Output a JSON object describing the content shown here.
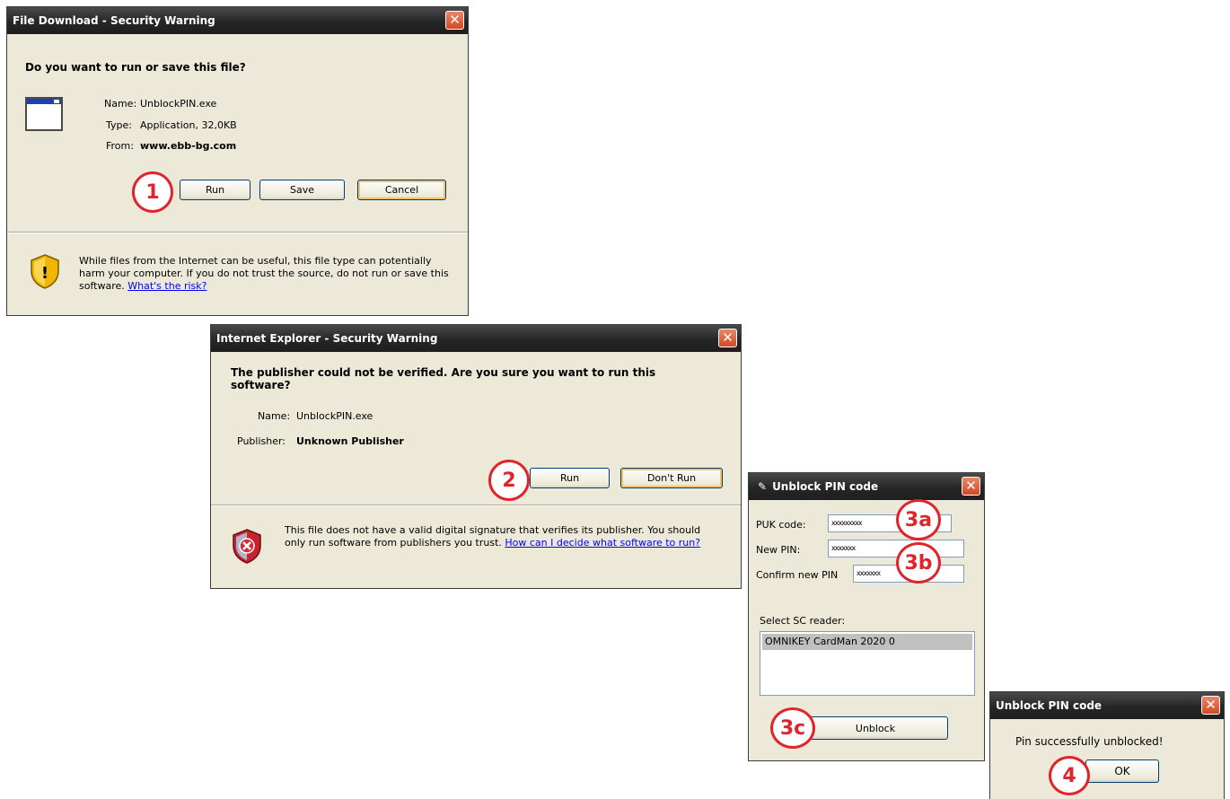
{
  "dialog1": {
    "title": "File Download - Security Warning",
    "close_glyph": "✕",
    "question": "Do you want to run or save this file?",
    "name_label": "Name:",
    "name_value": "UnblockPIN.exe",
    "type_label": "Type:",
    "type_value": "Application, 32,0KB",
    "from_label": "From:",
    "from_value": "www.ebb-bg.com",
    "run_label": "Run",
    "save_label": "Save",
    "cancel_label": "Cancel",
    "warning_text": "While files from the Internet can be useful, this file type can potentially harm your computer. If you do not trust the source, do not run or save this software.",
    "risk_link": "What's the risk?",
    "icon": "application-window-icon",
    "shield_icon": "warning-shield-icon"
  },
  "dialog2": {
    "title": "Internet Explorer - Security Warning",
    "close_glyph": "✕",
    "question": "The publisher could not be verified.  Are you sure you want to run this software?",
    "name_label": "Name:",
    "name_value": "UnblockPIN.exe",
    "publisher_label": "Publisher:",
    "publisher_value": "Unknown Publisher",
    "run_label": "Run",
    "dont_run_label": "Don't Run",
    "warning_text": "This file does not have a valid digital signature that verifies its publisher. You should only run software from publishers you trust.",
    "help_link": "How can I decide what software to run?",
    "shield_icon": "error-shield-icon"
  },
  "dialog3": {
    "title": "Unblock PIN code",
    "close_glyph": "✕",
    "puk_label": "PUK code:",
    "puk_value": "xxxxxxxxx",
    "new_pin_label": "New PIN:",
    "new_pin_value": "xxxxxxx",
    "confirm_pin_label": "Confirm new PIN",
    "confirm_pin_value": "xxxxxxx",
    "reader_label": "Select SC reader:",
    "readers": [
      "OMNIKEY CardMan 2020 0"
    ],
    "unblock_label": "Unblock"
  },
  "dialog4": {
    "title": "Unblock PIN code",
    "close_glyph": "✕",
    "message": "Pin successfully unblocked!",
    "ok_label": "OK"
  },
  "markers": {
    "step1": "1",
    "step2": "2",
    "step3a": "3a",
    "step3b": "3b",
    "step3c": "3c",
    "step4": "4"
  },
  "colors": {
    "marker_red": "#e0242c",
    "dialog_bg": "#ece9d8",
    "title_bg": "#262626",
    "link_blue": "#0000ff"
  }
}
